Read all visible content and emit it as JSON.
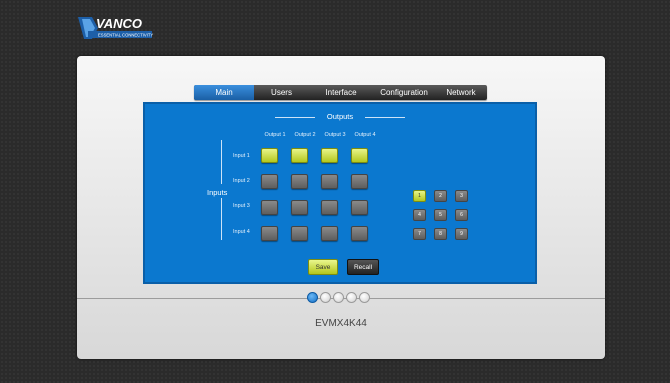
{
  "brand": {
    "name": "VANCO",
    "tagline": "ESSENTIAL CONNECTIVITY"
  },
  "tabs": [
    {
      "label": "Main",
      "active": true
    },
    {
      "label": "Users",
      "active": false
    },
    {
      "label": "Interface",
      "active": false
    },
    {
      "label": "Configuration",
      "active": false
    },
    {
      "label": "Network",
      "active": false
    }
  ],
  "matrix": {
    "outputs_title": "Outputs",
    "inputs_title": "Inputs",
    "outputs": [
      "Output 1",
      "Output 2",
      "Output 3",
      "Output 4"
    ],
    "inputs": [
      "Input 1",
      "Input 2",
      "Input 3",
      "Input 4"
    ],
    "routing": [
      [
        true,
        true,
        true,
        true
      ],
      [
        false,
        false,
        false,
        false
      ],
      [
        false,
        false,
        false,
        false
      ],
      [
        false,
        false,
        false,
        false
      ]
    ]
  },
  "presets": {
    "labels": [
      "1",
      "2",
      "3",
      "4",
      "5",
      "6",
      "7",
      "8",
      "9"
    ],
    "active": "1"
  },
  "actions": {
    "save_label": "Save",
    "recall_label": "Recall"
  },
  "pagination": {
    "count": 5,
    "active_index": 0
  },
  "device": {
    "model": "EVMX4K44"
  },
  "colors": {
    "accent_blue": "#0b78cf",
    "active_green": "#c8dc3c",
    "tab_active": "#2a7fd0"
  }
}
